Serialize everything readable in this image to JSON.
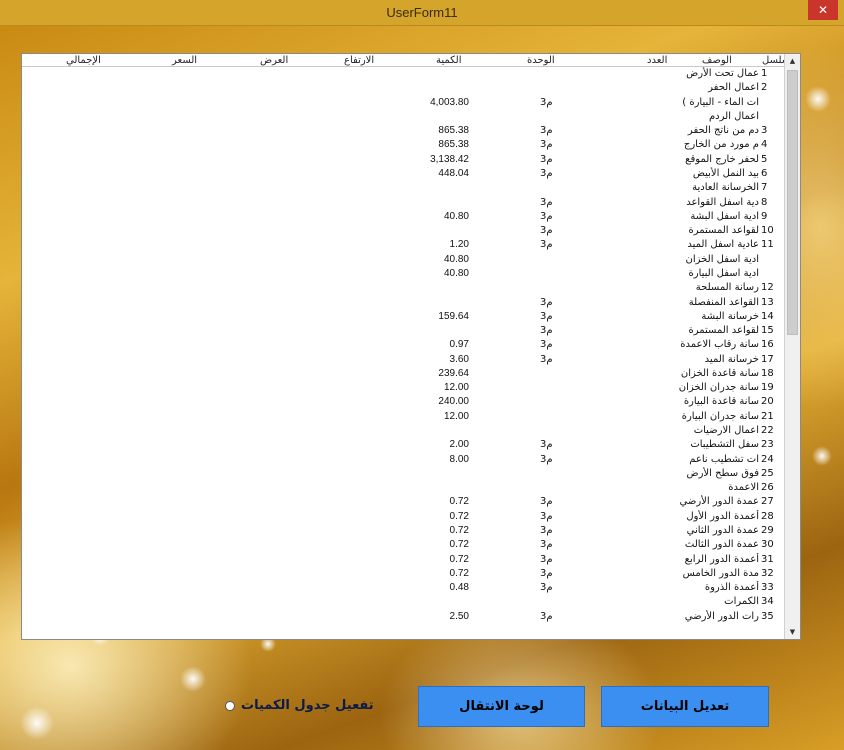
{
  "window": {
    "title": "UserForm11",
    "close_glyph": "✕"
  },
  "table": {
    "headers": {
      "serial": "المسلسل",
      "description": "الوصف",
      "count": "العدد",
      "unit": "الوحدة",
      "quantity": "الكمية",
      "height": "الارتفاع",
      "width": "العرض",
      "price": "السعر",
      "total": "الإجمالي"
    },
    "rows": [
      {
        "serial": "1",
        "description": "عمال تحت الأرض",
        "unit": "",
        "quantity": ""
      },
      {
        "serial": "2",
        "description": "اعمال الحفر",
        "unit": "",
        "quantity": ""
      },
      {
        "serial": "",
        "description": "ات الماء - البيارة )",
        "unit": "م3",
        "quantity": "4,003.80"
      },
      {
        "serial": "",
        "description": "اعمال الردم",
        "unit": "",
        "quantity": ""
      },
      {
        "serial": "3",
        "description": "دم من ناتج الحفر",
        "unit": "م3",
        "quantity": "865.38"
      },
      {
        "serial": "4",
        "description": "م مورد من الخارج",
        "unit": "م3",
        "quantity": "865.38"
      },
      {
        "serial": "5",
        "description": "لحفر خارج الموقع",
        "unit": "م3",
        "quantity": "3,138.42"
      },
      {
        "serial": "6",
        "description": "بيد النمل الأبيض",
        "unit": "م3",
        "quantity": "448.04"
      },
      {
        "serial": "7",
        "description": "الخرسانة العادية",
        "unit": "",
        "quantity": ""
      },
      {
        "serial": "8",
        "description": "دية اسفل القواعد",
        "unit": "م3",
        "quantity": ""
      },
      {
        "serial": "9",
        "description": "ادية اسفل البشة",
        "unit": "م3",
        "quantity": "40.80"
      },
      {
        "serial": "10",
        "description": "لقواعد المستمرة",
        "unit": "م3",
        "quantity": ""
      },
      {
        "serial": "11",
        "description": "عادية اسفل الميد",
        "unit": "م3",
        "quantity": "1.20"
      },
      {
        "serial": "",
        "description": "ادية اسفل الخزان",
        "unit": "",
        "quantity": "40.80"
      },
      {
        "serial": "",
        "description": "ادية اسفل البيارة",
        "unit": "",
        "quantity": "40.80"
      },
      {
        "serial": "12",
        "description": "رسانة المسلحة",
        "unit": "",
        "quantity": ""
      },
      {
        "serial": "13",
        "description": "القواعد المنفصلة",
        "unit": "م3",
        "quantity": ""
      },
      {
        "serial": "14",
        "description": "خرسانة البشة",
        "unit": "م3",
        "quantity": "159.64"
      },
      {
        "serial": "15",
        "description": "لقواعد المستمرة",
        "unit": "م3",
        "quantity": ""
      },
      {
        "serial": "16",
        "description": "سانة رقاب الاعمدة",
        "unit": "م3",
        "quantity": "0.97"
      },
      {
        "serial": "17",
        "description": "خرسانة الميد",
        "unit": "م3",
        "quantity": "3.60"
      },
      {
        "serial": "18",
        "description": "سانة قاعدة الخزان",
        "unit": "",
        "quantity": "239.64"
      },
      {
        "serial": "19",
        "description": "سانة جدران الخزان",
        "unit": "",
        "quantity": "12.00"
      },
      {
        "serial": "20",
        "description": "سانة قاعدة البيارة",
        "unit": "",
        "quantity": "240.00"
      },
      {
        "serial": "21",
        "description": "سانة جدران البيارة",
        "unit": "",
        "quantity": "12.00"
      },
      {
        "serial": "22",
        "description": "اعمال الارضيات",
        "unit": "",
        "quantity": ""
      },
      {
        "serial": "23",
        "description": "سفل التشطيبات",
        "unit": "م3",
        "quantity": "2.00"
      },
      {
        "serial": "24",
        "description": "ات تشطيب ناعم",
        "unit": "م3",
        "quantity": "8.00"
      },
      {
        "serial": "25",
        "description": "فوق سطح الأرض",
        "unit": "",
        "quantity": ""
      },
      {
        "serial": "26",
        "description": "الاعمدة",
        "unit": "",
        "quantity": ""
      },
      {
        "serial": "27",
        "description": "عمدة الدور الأرضي",
        "unit": "م3",
        "quantity": "0.72"
      },
      {
        "serial": "28",
        "description": "أعمدة الدور الأول",
        "unit": "م3",
        "quantity": "0.72"
      },
      {
        "serial": "29",
        "description": "عمدة الدور الثاني",
        "unit": "م3",
        "quantity": "0.72"
      },
      {
        "serial": "30",
        "description": "عمدة الدور الثالث",
        "unit": "م3",
        "quantity": "0.72"
      },
      {
        "serial": "31",
        "description": "أعمدة الدور الرابع",
        "unit": "م3",
        "quantity": "0.72"
      },
      {
        "serial": "32",
        "description": "مدة الدور الخامس",
        "unit": "م3",
        "quantity": "0.72"
      },
      {
        "serial": "33",
        "description": "أعمدة الذروة",
        "unit": "م3",
        "quantity": "0.48"
      },
      {
        "serial": "34",
        "description": "الكمرات",
        "unit": "",
        "quantity": ""
      },
      {
        "serial": "35",
        "description": "رات الدور الأرضي",
        "unit": "م3",
        "quantity": "2.50"
      }
    ],
    "scroll_up_glyph": "▲",
    "scroll_down_glyph": "▼"
  },
  "buttons": {
    "edit_data": "تعديل البيانات",
    "navigation_panel": "لوحة الانتقال"
  },
  "radio": {
    "label": "تفعيل جدول الكميات",
    "checked": false
  },
  "colors": {
    "button_blue": "#3a8ff0",
    "close_red": "#c9352b"
  }
}
